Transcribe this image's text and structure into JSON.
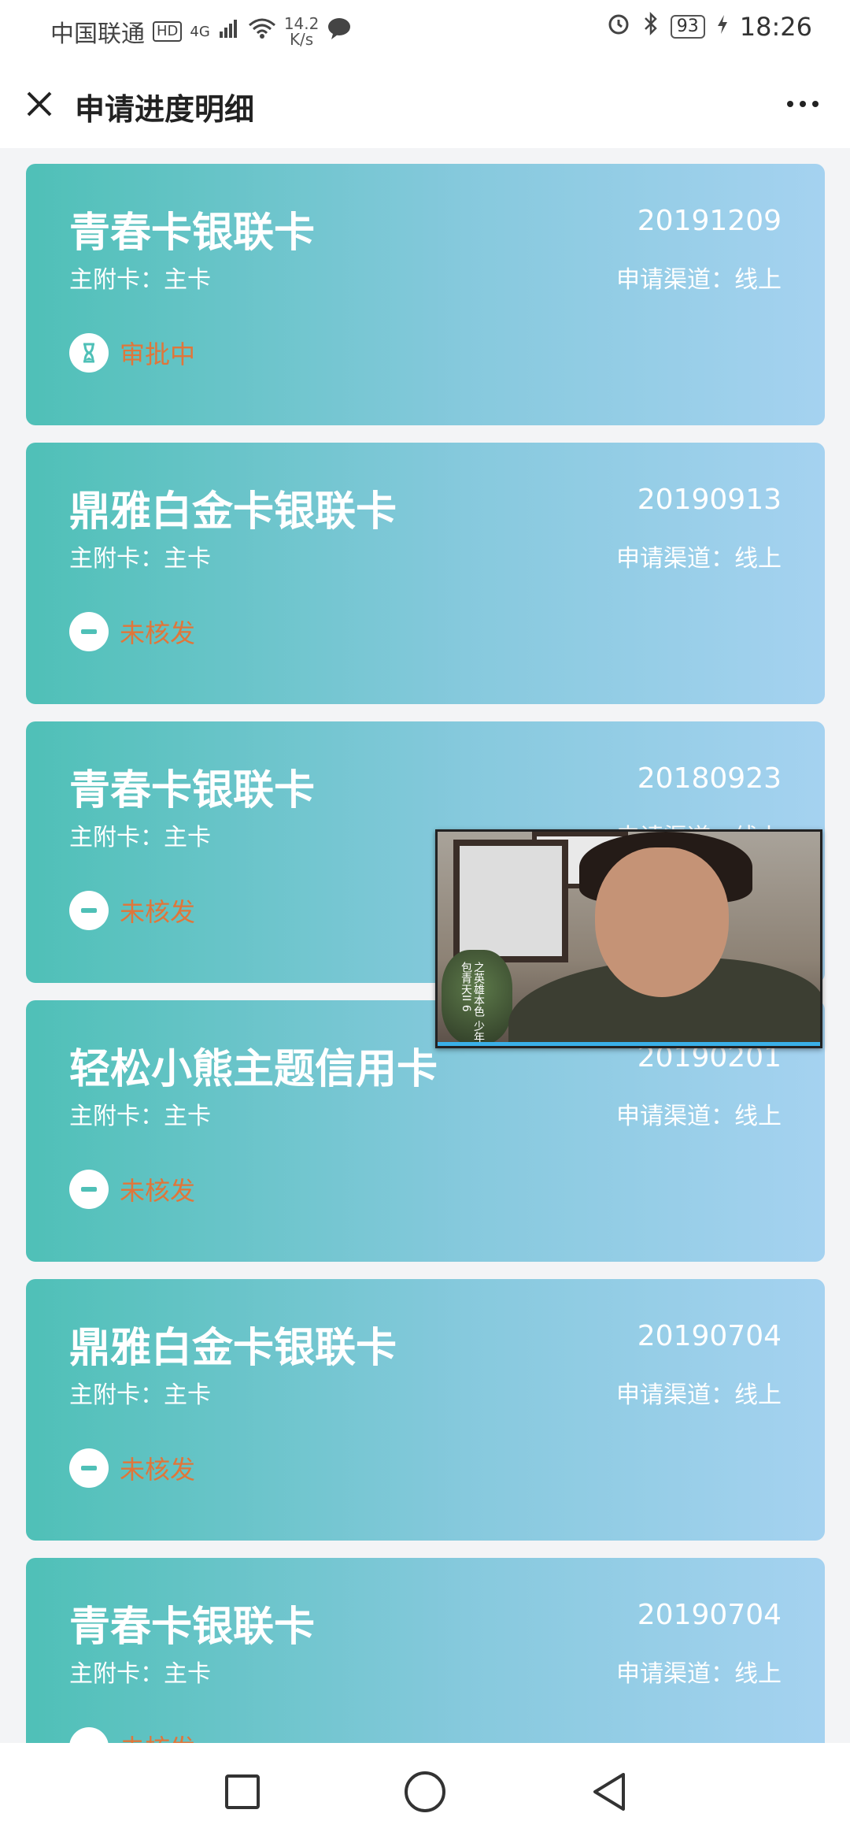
{
  "status_bar": {
    "carrier": "中国联通",
    "hd": "HD",
    "network": "4G",
    "speed_value": "14.2",
    "speed_unit": "K/s",
    "battery": "93",
    "time": "18:26"
  },
  "header": {
    "title": "申请进度明细"
  },
  "cards": [
    {
      "name": "青春卡银联卡",
      "date": "20191209",
      "type": "主附卡：主卡",
      "channel": "申请渠道：线上",
      "status": "审批中",
      "status_icon": "hourglass-icon"
    },
    {
      "name": "鼎雅白金卡银联卡",
      "date": "20190913",
      "type": "主附卡：主卡",
      "channel": "申请渠道：线上",
      "status": "未核发",
      "status_icon": "minus-icon"
    },
    {
      "name": "青春卡银联卡",
      "date": "20180923",
      "type": "主附卡：主卡",
      "channel": "申请渠道：线上",
      "status": "未核发",
      "status_icon": "minus-icon"
    },
    {
      "name": "轻松小熊主题信用卡",
      "date": "20190201",
      "type": "主附卡：主卡",
      "channel": "申请渠道：线上",
      "status": "未核发",
      "status_icon": "minus-icon"
    },
    {
      "name": "鼎雅白金卡银联卡",
      "date": "20190704",
      "type": "主附卡：主卡",
      "channel": "申请渠道：线上",
      "status": "未核发",
      "status_icon": "minus-icon"
    },
    {
      "name": "青春卡银联卡",
      "date": "20190704",
      "type": "主附卡：主卡",
      "channel": "申请渠道：线上",
      "status": "未核发",
      "status_icon": "minus-icon"
    }
  ],
  "video": {
    "caption": "之英雄本色 少年包青天II 6"
  },
  "colors": {
    "status_text": "#e0763a",
    "card_gradient_start": "#4fc0b7",
    "card_gradient_end": "#a5d2f0"
  }
}
